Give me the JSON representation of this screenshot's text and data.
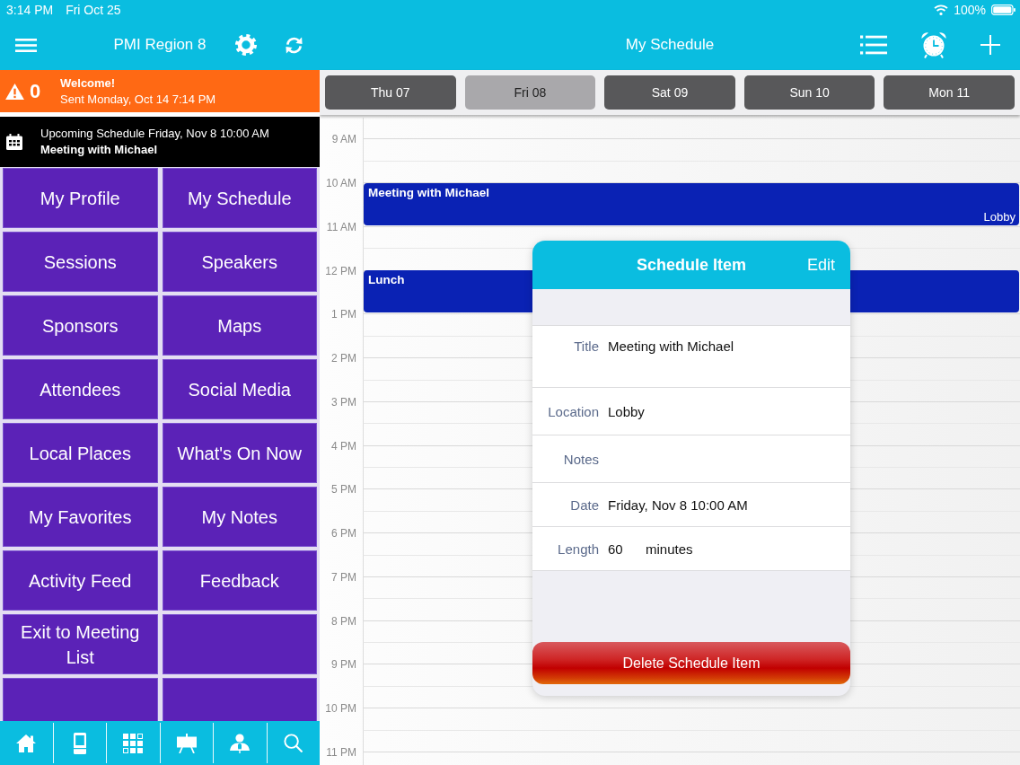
{
  "status_bar": {
    "time": "3:14 PM",
    "date": "Fri Oct 25",
    "battery": "100%"
  },
  "sidebar": {
    "title": "PMI Region 8",
    "alert": {
      "count": "0",
      "title": "Welcome!",
      "sent": "Sent Monday, Oct 14 7:14 PM"
    },
    "upcoming": {
      "heading": "Upcoming Schedule Friday, Nov 8 10:00 AM",
      "title": "Meeting with Michael"
    },
    "tiles": [
      {
        "kind": "link",
        "label": "My Profile"
      },
      {
        "kind": "link",
        "label": "My Schedule"
      },
      {
        "kind": "link",
        "label": "Sessions"
      },
      {
        "kind": "link",
        "label": "Speakers"
      },
      {
        "kind": "link",
        "label": "Sponsors"
      },
      {
        "kind": "link",
        "label": "Maps"
      },
      {
        "kind": "link",
        "label": "Attendees"
      },
      {
        "kind": "link",
        "label": "Social Media"
      },
      {
        "kind": "link",
        "label": "Local Places"
      },
      {
        "kind": "link",
        "label": "What's On Now"
      },
      {
        "kind": "link",
        "label": "My Favorites"
      },
      {
        "kind": "link",
        "label": "My Notes"
      },
      {
        "kind": "link",
        "label": "Activity Feed"
      },
      {
        "kind": "link",
        "label": "Feedback"
      },
      {
        "kind": "link",
        "label": "Exit to Meeting List"
      },
      {
        "kind": "empty"
      },
      {
        "kind": "empty"
      },
      {
        "kind": "empty"
      }
    ]
  },
  "schedule": {
    "title": "My Schedule",
    "days": [
      {
        "label": "Thu 07",
        "selected": false
      },
      {
        "label": "Fri 08",
        "selected": true
      },
      {
        "label": "Sat 09",
        "selected": false
      },
      {
        "label": "Sun 10",
        "selected": false
      },
      {
        "label": "Mon 11",
        "selected": false
      }
    ],
    "hours": [
      {
        "label": "9 AM"
      },
      {
        "label": "10 AM",
        "events": [
          {
            "title": "Meeting with Michael",
            "location": "Lobby"
          }
        ]
      },
      {
        "label": "11 AM"
      },
      {
        "label": "12 PM",
        "events": [
          {
            "title": "Lunch"
          }
        ]
      },
      {
        "label": "1 PM"
      },
      {
        "label": "2 PM"
      },
      {
        "label": "3 PM"
      },
      {
        "label": "4 PM"
      },
      {
        "label": "5 PM"
      },
      {
        "label": "6 PM"
      },
      {
        "label": "7 PM"
      },
      {
        "label": "8 PM"
      },
      {
        "label": "9 PM"
      },
      {
        "label": "10 PM"
      },
      {
        "label": "11 PM"
      }
    ]
  },
  "popover": {
    "title": "Schedule Item",
    "action": "Edit",
    "fields": [
      {
        "kind": "multiline",
        "label": "Title",
        "value": "Meeting with Michael"
      },
      {
        "kind": "text",
        "label": "Location",
        "value": "Lobby"
      },
      {
        "kind": "text",
        "label": "Notes"
      },
      {
        "kind": "text",
        "label": "Date",
        "value": "Friday, Nov 8 10:00 AM"
      },
      {
        "kind": "number",
        "label": "Length",
        "value": "60",
        "unit": "minutes"
      }
    ],
    "delete_label": "Delete Schedule Item"
  }
}
